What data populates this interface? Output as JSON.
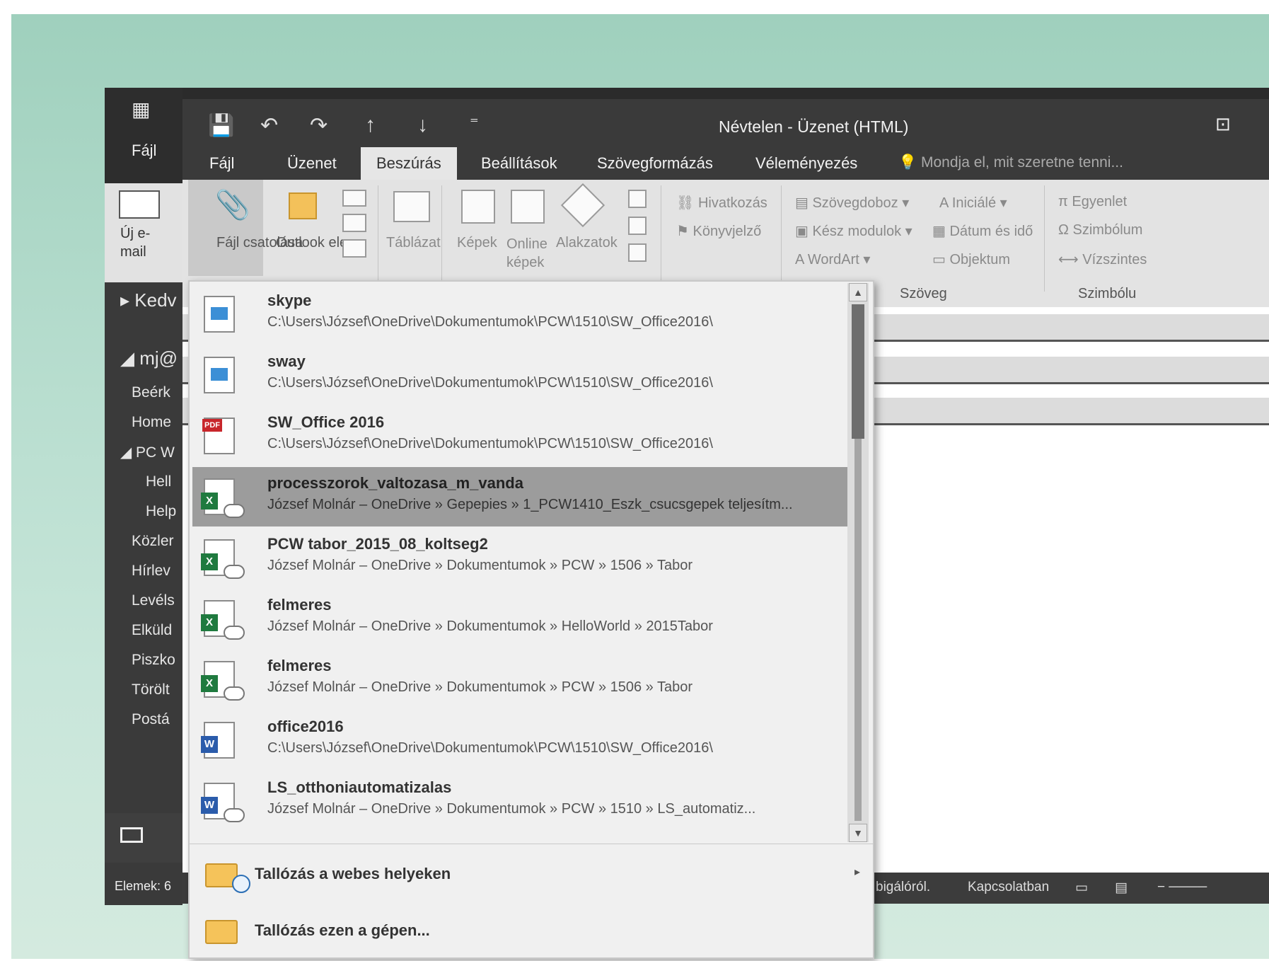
{
  "outlook_main": {
    "file_label": "Fájl",
    "new_mail_label": "Új e-mail",
    "favorites_label": "Kedv",
    "account_label": "mj@",
    "folders": [
      "Beérk",
      "Home",
      "PC W",
      "Hell",
      "Help",
      "Közler",
      "Hírlev",
      "Levéls",
      "Elküld",
      "Piszko",
      "Törölt",
      "Postá"
    ],
    "status_left": "Elemek: 6"
  },
  "message_window": {
    "title": "Névtelen - Üzenet (HTML)",
    "tabs": [
      "Fájl",
      "Üzenet",
      "Beszúrás",
      "Beállítások",
      "Szövegformázás",
      "Véleményezés"
    ],
    "active_tab": "Beszúrás",
    "tell_me": "Mondja el, mit szeretne tenni..."
  },
  "ribbon": {
    "attach_file": "Fájl csatolása",
    "outlook_item": "Outlook elem",
    "table": "Táblázat",
    "pictures": "Képek",
    "online_pictures": "Online képek",
    "shapes": "Alakzatok",
    "link": "Hivatkozás",
    "bookmark": "Könyvjelző",
    "text_box": "Szövegdoboz",
    "quick_parts": "Kész modulok",
    "wordart": "WordArt",
    "drop_cap": "Iniciálé",
    "date_time": "Dátum és idő",
    "object": "Objektum",
    "equation": "Egyenlet",
    "symbol": "Szimbólum",
    "horizontal_line": "Vízszintes",
    "group_text": "Szöveg",
    "group_symbols": "Szimbólu"
  },
  "statusbar": {
    "text1": "bigálóról.",
    "text2": "Kapcsolatban"
  },
  "recent_items": [
    {
      "name": "skype",
      "path": "C:\\Users\\József\\OneDrive\\Dokumentumok\\PCW\\1510\\SW_Office2016\\",
      "icon": "image-file-icon",
      "selected": false
    },
    {
      "name": "sway",
      "path": "C:\\Users\\József\\OneDrive\\Dokumentumok\\PCW\\1510\\SW_Office2016\\",
      "icon": "image-file-icon",
      "selected": false
    },
    {
      "name": "SW_Office 2016",
      "path": "C:\\Users\\József\\OneDrive\\Dokumentumok\\PCW\\1510\\SW_Office2016\\",
      "icon": "pdf-file-icon",
      "selected": false
    },
    {
      "name": "processzorok_valtozasa_m_vanda",
      "path": "József Molnár – OneDrive » Gepepies » 1_PCW1410_Eszk_csucsgepek teljesítm...",
      "icon": "excel-cloud-icon",
      "selected": true
    },
    {
      "name": "PCW tabor_2015_08_koltseg2",
      "path": "József Molnár – OneDrive » Dokumentumok » PCW » 1506 » Tabor",
      "icon": "excel-cloud-icon",
      "selected": false
    },
    {
      "name": "felmeres",
      "path": "József Molnár – OneDrive » Dokumentumok » HelloWorld » 2015Tabor",
      "icon": "excel-cloud-icon",
      "selected": false
    },
    {
      "name": "felmeres",
      "path": "József Molnár – OneDrive » Dokumentumok » PCW » 1506 » Tabor",
      "icon": "excel-cloud-icon",
      "selected": false
    },
    {
      "name": "office2016",
      "path": "C:\\Users\\József\\OneDrive\\Dokumentumok\\PCW\\1510\\SW_Office2016\\",
      "icon": "word-file-icon",
      "selected": false
    },
    {
      "name": "LS_otthoniautomatizalas",
      "path": "József Molnár – OneDrive » Dokumentumok » PCW » 1510 » LS_automatiz...",
      "icon": "word-cloud-icon",
      "selected": false
    }
  ],
  "browse": {
    "web_locations": "Tallózás a webes helyeken",
    "this_pc": "Tallózás ezen a gépen..."
  }
}
